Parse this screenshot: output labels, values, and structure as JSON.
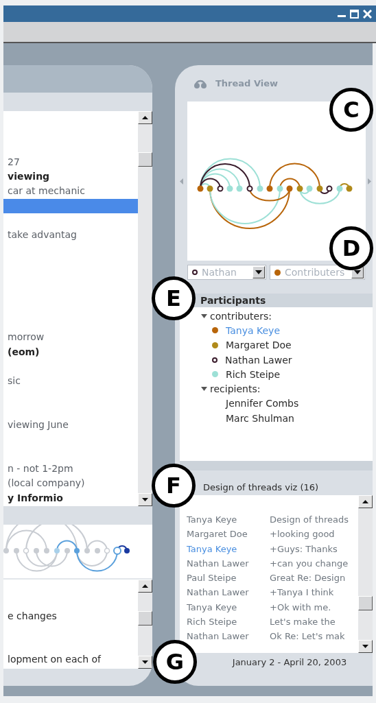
{
  "mail_list": {
    "rows": [
      {
        "selected": false
      },
      {
        "selected": false
      },
      {
        "selected": false
      },
      {
        "text": "27",
        "bold": false,
        "selected": false
      },
      {
        "text": "viewing",
        "bold": true,
        "selected": false
      },
      {
        "text": "car at mechanic",
        "bold": false,
        "selected": false
      },
      {
        "selected": true
      },
      {
        "selected": false
      },
      {
        "text": "take advantag",
        "bold": false,
        "selected": false
      },
      {
        "selected": false
      },
      {
        "selected": false
      },
      {
        "selected": false
      },
      {
        "selected": false
      },
      {
        "selected": false
      },
      {
        "selected": false
      },
      {
        "text": "morrow",
        "bold": false,
        "selected": false
      },
      {
        "text": "(eom)",
        "bold": true,
        "selected": false
      },
      {
        "selected": false
      },
      {
        "text": "sic",
        "bold": false,
        "selected": false
      },
      {
        "selected": false
      },
      {
        "selected": false
      },
      {
        "text": "viewing June",
        "bold": false,
        "selected": false
      },
      {
        "selected": false
      },
      {
        "selected": false
      },
      {
        "text": "n - not 1-2pm",
        "bold": false,
        "selected": false
      },
      {
        "text": "(local company)",
        "bold": false,
        "selected": false
      },
      {
        "text": "y Informio",
        "bold": true,
        "selected": false
      }
    ]
  },
  "mail_preview": {
    "rows": [
      {
        "selected": false
      },
      {
        "selected": false
      },
      {
        "text": "e changes",
        "selected": false
      },
      {
        "selected": false
      },
      {
        "selected": false
      },
      {
        "text": "lopment on each of",
        "selected": false
      }
    ]
  },
  "thread_view": {
    "title": "Thread View",
    "filters": [
      {
        "value": "Nathan",
        "kind": "ring",
        "color": "#3a1c2c"
      },
      {
        "value": "Contributers",
        "kind": "dot",
        "color": "#b8650a"
      }
    ]
  },
  "participants": {
    "title": "Participants",
    "groups": [
      {
        "label": "contributers:",
        "expanded": true,
        "children": [
          {
            "name": "Tanya Keye",
            "kind": "dot",
            "color": "#b8650a",
            "selected": true
          },
          {
            "name": "Margaret Doe",
            "kind": "dot",
            "color": "#b08a1a",
            "selected": false
          },
          {
            "name": "Nathan Lawer",
            "kind": "ring",
            "color": "#3a1c2c",
            "selected": false
          },
          {
            "name": "Rich Steipe",
            "kind": "dot",
            "color": "#9de0d6",
            "selected": false
          }
        ]
      },
      {
        "label": "recipients:",
        "expanded": true,
        "children": [
          {
            "name": "Jennifer Combs",
            "kind": "plain",
            "selected": false
          },
          {
            "name": "Marc Shulman",
            "kind": "plain",
            "selected": false
          }
        ]
      }
    ]
  },
  "thread": {
    "title": "Design of threads viz (16)",
    "messages": [
      {
        "from": "Tanya Keye",
        "subject": "Design of threads",
        "selected": false
      },
      {
        "from": "Margaret Doe",
        "subject": "+looking good",
        "selected": false
      },
      {
        "from": "Tanya Keye",
        "subject": "+Guys: Thanks",
        "selected": true
      },
      {
        "from": "Nathan Lawer",
        "subject": "+can you change",
        "selected": false
      },
      {
        "from": "Paul Steipe",
        "subject": "Great Re: Design",
        "selected": false
      },
      {
        "from": "Nathan Lawer",
        "subject": "+Tanya I think",
        "selected": false
      },
      {
        "from": "Tanya Keye",
        "subject": "+Ok with me.",
        "selected": false
      },
      {
        "from": "Rich Steipe",
        "subject": "Let's make the",
        "selected": false
      },
      {
        "from": "Nathan Lawer",
        "subject": "Ok Re: Let's mak",
        "selected": false
      }
    ],
    "date_range": "January 2 - April 20, 2003"
  },
  "callouts": [
    "C",
    "D",
    "E",
    "F",
    "G"
  ]
}
